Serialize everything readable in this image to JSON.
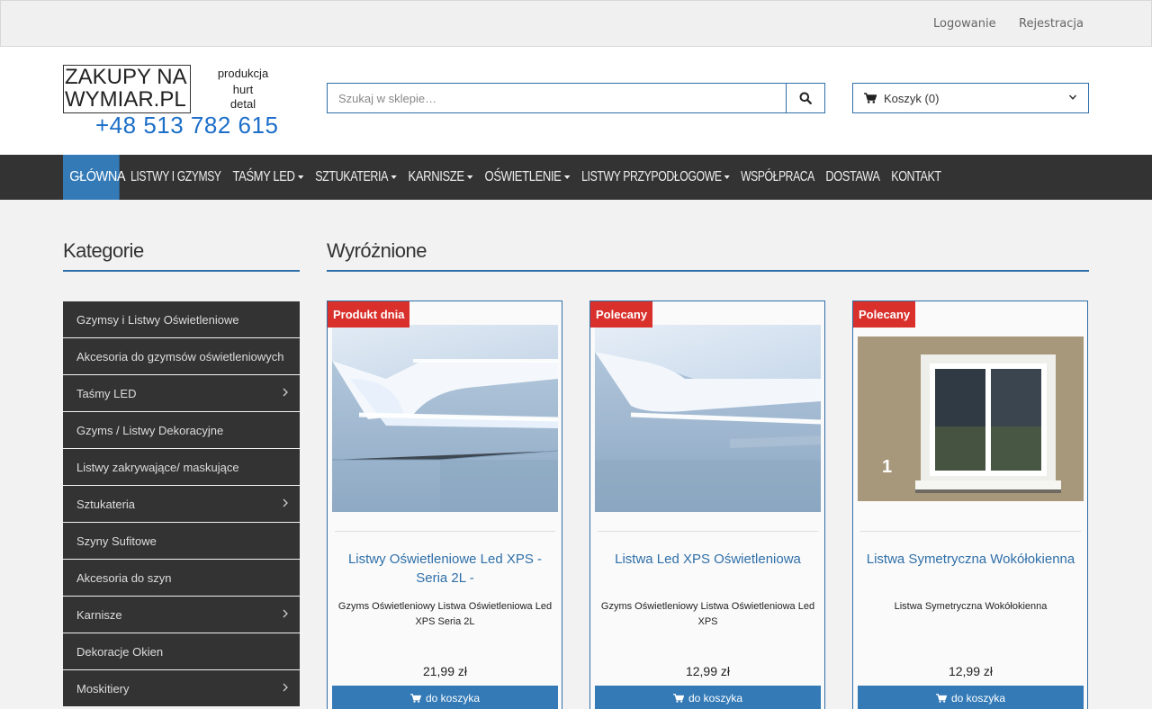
{
  "topbar": {
    "login": "Logowanie",
    "register": "Rejestracja"
  },
  "logo": {
    "line1": "ZAKUPY NA",
    "line2": "WYMIAR.PL",
    "tag1": "produkcja",
    "tag2": "hurt",
    "tag3": "detal",
    "phone": "+48 513 782 615"
  },
  "search": {
    "placeholder": "Szukaj w sklepie…",
    "icon": "search-icon"
  },
  "cart": {
    "label": "Koszyk (0)",
    "icon": "cart-icon"
  },
  "nav": [
    {
      "label": "GŁÓWNA",
      "active": true
    },
    {
      "label": "LISTWY I GZYMSY",
      "dropdown": false
    },
    {
      "label": "TAŚMY LED",
      "dropdown": true
    },
    {
      "label": "SZTUKATERIA",
      "dropdown": true
    },
    {
      "label": "KARNISZE",
      "dropdown": true
    },
    {
      "label": "OŚWIETLENIE",
      "dropdown": true
    },
    {
      "label": "LISTWY PRZYPODŁOGOWE",
      "dropdown": true
    },
    {
      "label": "WSPÓŁPRACA",
      "dropdown": false
    },
    {
      "label": "DOSTAWA",
      "dropdown": false
    },
    {
      "label": "KONTAKT",
      "dropdown": false
    }
  ],
  "sidebar": {
    "title": "Kategorie",
    "items": [
      {
        "label": "Gzymsy i Listwy Oświetleniowe",
        "has_sub": false
      },
      {
        "label": "Akcesoria do gzymsów oświetleniowych",
        "has_sub": false
      },
      {
        "label": "Taśmy LED",
        "has_sub": true
      },
      {
        "label": "Gzyms / Listwy Dekoracyjne",
        "has_sub": false
      },
      {
        "label": "Listwy zakrywające/ maskujące",
        "has_sub": false
      },
      {
        "label": "Sztukateria",
        "has_sub": true
      },
      {
        "label": "Szyny Sufitowe",
        "has_sub": false
      },
      {
        "label": "Akcesoria do szyn",
        "has_sub": false
      },
      {
        "label": "Karnisze",
        "has_sub": true
      },
      {
        "label": "Dekoracje Okien",
        "has_sub": false
      },
      {
        "label": "Moskitiery",
        "has_sub": true
      }
    ]
  },
  "featured": {
    "title": "Wyróżnione",
    "products": [
      {
        "badge": "Produkt dnia",
        "name": "Listwy Oświetleniowe Led XPS - Seria 2L -",
        "description": "Gzyms Oświetleniowy Listwa Oświetleniowa Led XPS Seria 2L",
        "price": "21,99 zł",
        "button": "do koszyka"
      },
      {
        "badge": "Polecany",
        "name": "Listwa Led XPS Oświetleniowa",
        "description": "Gzyms Oświetleniowy Listwa Oświetleniowa Led XPS",
        "price": "12,99 zł",
        "button": "do koszyka"
      },
      {
        "badge": "Polecany",
        "name": "Listwa Symetryczna Wokółokienna",
        "description": "Listwa Symetryczna Wokółokienna",
        "price": "12,99 zł",
        "button": "do koszyka",
        "image_number": "1"
      }
    ]
  },
  "colors": {
    "accent": "#337ab7",
    "nav_bg": "#333333",
    "badge": "#d9302c"
  }
}
